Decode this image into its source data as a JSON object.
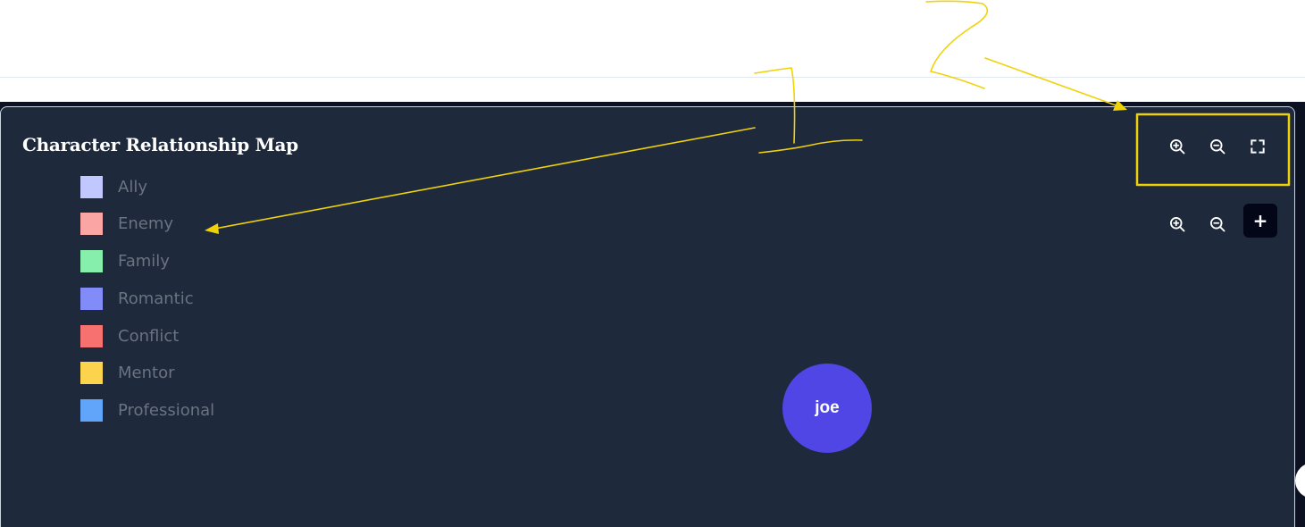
{
  "panel": {
    "title": "Character Relationship Map"
  },
  "toolbar": {
    "top": [
      {
        "icon": "zoom-in-icon"
      },
      {
        "icon": "zoom-out-icon"
      },
      {
        "icon": "fullscreen-icon"
      }
    ],
    "inner": [
      {
        "icon": "zoom-in-icon"
      },
      {
        "icon": "zoom-out-icon"
      },
      {
        "icon": "plus-icon",
        "label": "+"
      }
    ]
  },
  "legend": {
    "items": [
      {
        "label": "Ally",
        "color": "#c0c8ff"
      },
      {
        "label": "Enemy",
        "color": "#fca5a5"
      },
      {
        "label": "Family",
        "color": "#86efac"
      },
      {
        "label": "Romantic",
        "color": "#818cf8"
      },
      {
        "label": "Conflict",
        "color": "#f87171"
      },
      {
        "label": "Mentor",
        "color": "#fcd34d"
      },
      {
        "label": "Professional",
        "color": "#60a5fa"
      }
    ]
  },
  "graph": {
    "nodes": [
      {
        "label": "joe",
        "color": "#4f46e5"
      }
    ]
  },
  "colors": {
    "panel_bg": "#1e293b",
    "annotation": "#f0d20a"
  }
}
